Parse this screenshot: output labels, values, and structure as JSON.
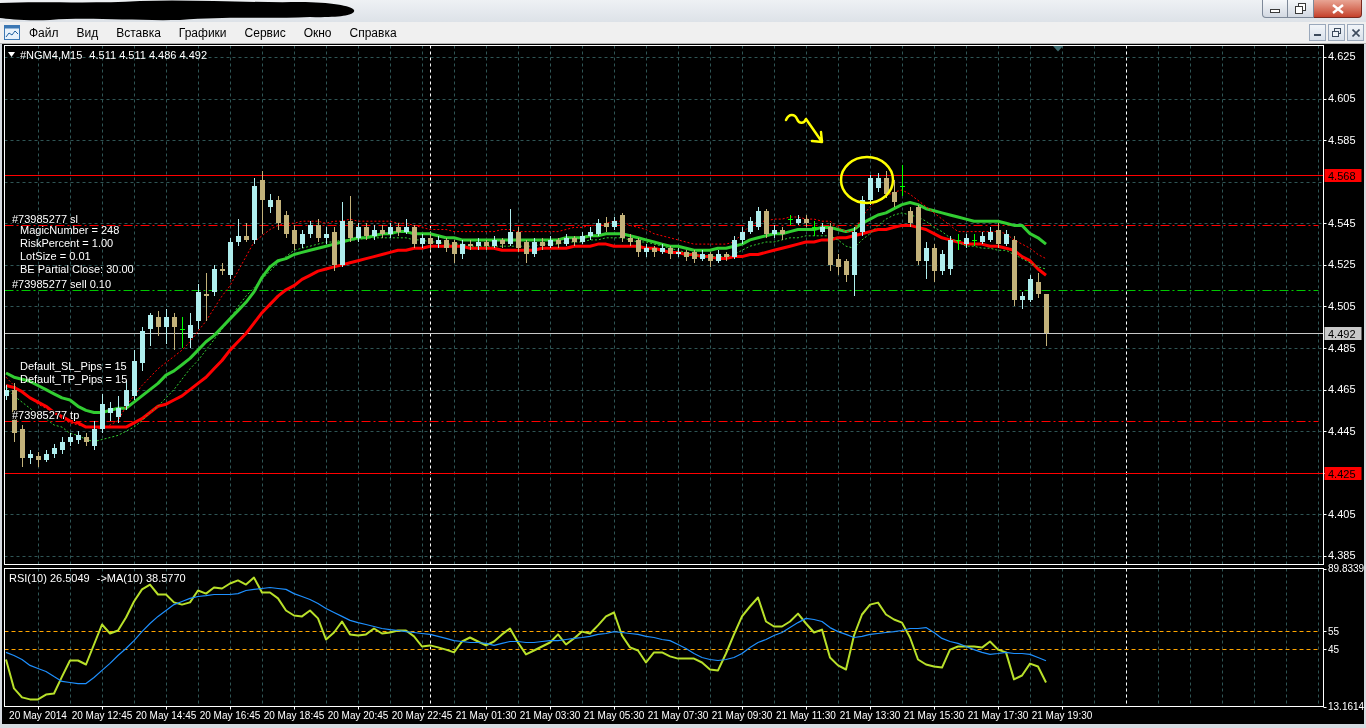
{
  "menu_bar": {
    "items": [
      "Файл",
      "Вид",
      "Вставка",
      "Графики",
      "Сервис",
      "Окно",
      "Справка"
    ]
  },
  "chart": {
    "comment_groups": [
      [
        "MagicNumber = 248",
        "RiskPercent = 1.00",
        "LotSize = 0.01",
        "BE Partial Close: 30.00"
      ],
      [
        "Default_SL_Pips = 15",
        "Default_TP_Pips = 15"
      ]
    ],
    "chart_data": [
      {
        "type": "candlestick",
        "title": "#NGM4,M15",
        "subtitle": "4.511 4.511 4.486 4.492",
        "ylim": [
          4.3809,
          4.6305
        ],
        "yticks": [
          4.385,
          4.405,
          4.425,
          4.445,
          4.465,
          4.485,
          4.505,
          4.525,
          4.545,
          4.585,
          4.605,
          4.625
        ],
        "grid": true,
        "ohlc": [
          [
            4.462,
            4.467,
            4.46,
            4.465
          ],
          [
            4.465,
            4.468,
            4.44,
            4.444
          ],
          [
            4.446,
            4.448,
            4.428,
            4.432
          ],
          [
            4.432,
            4.436,
            4.429,
            4.434
          ],
          [
            4.433,
            4.435,
            4.428,
            4.431
          ],
          [
            4.431,
            4.436,
            4.43,
            4.434
          ],
          [
            4.434,
            4.439,
            4.432,
            4.437
          ],
          [
            4.436,
            4.442,
            4.434,
            4.44
          ],
          [
            4.44,
            4.444,
            4.438,
            4.442
          ],
          [
            4.441,
            4.445,
            4.439,
            4.443
          ],
          [
            4.442,
            4.444,
            4.438,
            4.44
          ],
          [
            4.438,
            4.45,
            4.436,
            4.446
          ],
          [
            4.446,
            4.463,
            4.444,
            4.458
          ],
          [
            4.454,
            4.459,
            4.45,
            4.456
          ],
          [
            4.452,
            4.462,
            4.449,
            4.456
          ],
          [
            4.457,
            4.469,
            4.455,
            4.465
          ],
          [
            4.462,
            4.484,
            4.46,
            4.479
          ],
          [
            4.478,
            4.495,
            4.474,
            4.493
          ],
          [
            4.494,
            4.502,
            4.486,
            4.501
          ],
          [
            4.5,
            4.503,
            4.491,
            4.495
          ],
          [
            4.495,
            4.504,
            4.487,
            4.5
          ],
          [
            4.5,
            4.502,
            4.484,
            4.495
          ],
          [
            4.494,
            4.5,
            4.485,
            4.494
          ],
          [
            4.49,
            4.502,
            4.485,
            4.496
          ],
          [
            4.498,
            4.516,
            4.494,
            4.512
          ],
          [
            4.511,
            4.521,
            4.498,
            4.51
          ],
          [
            4.512,
            4.525,
            4.51,
            4.523
          ],
          [
            4.523,
            4.526,
            4.52,
            4.522
          ],
          [
            4.52,
            4.538,
            4.518,
            4.536
          ],
          [
            4.536,
            4.547,
            4.534,
            4.539
          ],
          [
            4.539,
            4.545,
            4.536,
            4.537
          ],
          [
            4.537,
            4.567,
            4.535,
            4.563
          ],
          [
            4.566,
            4.57,
            4.54,
            4.556
          ],
          [
            4.553,
            4.559,
            4.55,
            4.556
          ],
          [
            4.556,
            4.558,
            4.542,
            4.545
          ],
          [
            4.549,
            4.551,
            4.538,
            4.54
          ],
          [
            4.542,
            4.544,
            4.532,
            4.535
          ],
          [
            4.535,
            4.542,
            4.533,
            4.54
          ],
          [
            4.54,
            4.546,
            4.538,
            4.544
          ],
          [
            4.544,
            4.547,
            4.536,
            4.538
          ],
          [
            4.538,
            4.543,
            4.535,
            4.54
          ],
          [
            4.541,
            4.543,
            4.522,
            4.525
          ],
          [
            4.525,
            4.555,
            4.524,
            4.546
          ],
          [
            4.546,
            4.558,
            4.536,
            4.538
          ],
          [
            4.538,
            4.545,
            4.536,
            4.543
          ],
          [
            4.543,
            4.545,
            4.537,
            4.539
          ],
          [
            4.539,
            4.544,
            4.537,
            4.542
          ],
          [
            4.542,
            4.544,
            4.538,
            4.54
          ],
          [
            4.54,
            4.545,
            4.538,
            4.543
          ],
          [
            4.543,
            4.545,
            4.539,
            4.541
          ],
          [
            4.541,
            4.547,
            4.54,
            4.543
          ],
          [
            4.543,
            4.544,
            4.533,
            4.535
          ],
          [
            4.535,
            4.54,
            4.533,
            4.538
          ],
          [
            4.538,
            4.54,
            4.532,
            4.535
          ],
          [
            4.535,
            4.539,
            4.533,
            4.537
          ],
          [
            4.537,
            4.538,
            4.531,
            4.533
          ],
          [
            4.536,
            4.537,
            4.526,
            4.53
          ],
          [
            4.53,
            4.537,
            4.528,
            4.535
          ],
          [
            4.535,
            4.537,
            4.532,
            4.534
          ],
          [
            4.534,
            4.538,
            4.532,
            4.536
          ],
          [
            4.536,
            4.537,
            4.532,
            4.534
          ],
          [
            4.534,
            4.539,
            4.533,
            4.537
          ],
          [
            4.537,
            4.538,
            4.533,
            4.535
          ],
          [
            4.535,
            4.552,
            4.534,
            4.541
          ],
          [
            4.541,
            4.543,
            4.531,
            4.533
          ],
          [
            4.536,
            4.537,
            4.526,
            4.53
          ],
          [
            4.53,
            4.538,
            4.529,
            4.536
          ],
          [
            4.536,
            4.538,
            4.532,
            4.534
          ],
          [
            4.534,
            4.539,
            4.533,
            4.537
          ],
          [
            4.537,
            4.538,
            4.533,
            4.535
          ],
          [
            4.535,
            4.54,
            4.534,
            4.538
          ],
          [
            4.538,
            4.539,
            4.534,
            4.536
          ],
          [
            4.536,
            4.541,
            4.535,
            4.539
          ],
          [
            4.539,
            4.543,
            4.537,
            4.541
          ],
          [
            4.54,
            4.547,
            4.539,
            4.545
          ],
          [
            4.545,
            4.548,
            4.541,
            4.543
          ],
          [
            4.543,
            4.548,
            4.542,
            4.546
          ],
          [
            4.549,
            4.55,
            4.536,
            4.538
          ],
          [
            4.538,
            4.54,
            4.534,
            4.536
          ],
          [
            4.537,
            4.538,
            4.529,
            4.531
          ],
          [
            4.531,
            4.535,
            4.529,
            4.533
          ],
          [
            4.533,
            4.534,
            4.529,
            4.531
          ],
          [
            4.531,
            4.535,
            4.53,
            4.533
          ],
          [
            4.533,
            4.534,
            4.528,
            4.53
          ],
          [
            4.53,
            4.533,
            4.529,
            4.531
          ],
          [
            4.531,
            4.532,
            4.527,
            4.529
          ],
          [
            4.531,
            4.532,
            4.526,
            4.528
          ],
          [
            4.528,
            4.532,
            4.527,
            4.53
          ],
          [
            4.53,
            4.531,
            4.524,
            4.527
          ],
          [
            4.527,
            4.532,
            4.526,
            4.53
          ],
          [
            4.53,
            4.531,
            4.527,
            4.529
          ],
          [
            4.529,
            4.539,
            4.528,
            4.537
          ],
          [
            4.537,
            4.543,
            4.535,
            4.541
          ],
          [
            4.541,
            4.548,
            4.54,
            4.546
          ],
          [
            4.543,
            4.553,
            4.542,
            4.551
          ],
          [
            4.551,
            4.552,
            4.538,
            4.54
          ],
          [
            4.54,
            4.544,
            4.538,
            4.542
          ],
          [
            4.542,
            4.543,
            4.537,
            4.54
          ],
          [
            4.547,
            4.549,
            4.544,
            4.547
          ],
          [
            4.545,
            4.549,
            4.544,
            4.547
          ],
          [
            4.547,
            4.549,
            4.543,
            4.545
          ],
          [
            4.543,
            4.546,
            4.539,
            4.543
          ],
          [
            4.541,
            4.545,
            4.54,
            4.543
          ],
          [
            4.543,
            4.545,
            4.522,
            4.525
          ],
          [
            4.528,
            4.53,
            4.52,
            4.524
          ],
          [
            4.527,
            4.528,
            4.517,
            4.52
          ],
          [
            4.52,
            4.543,
            4.51,
            4.541
          ],
          [
            4.541,
            4.558,
            4.539,
            4.556
          ],
          [
            4.556,
            4.568,
            4.554,
            4.567
          ],
          [
            4.562,
            4.569,
            4.56,
            4.567
          ],
          [
            4.567,
            4.57,
            4.557,
            4.559
          ],
          [
            4.56,
            4.566,
            4.553,
            4.555
          ],
          [
            4.563,
            4.573,
            4.558,
            4.563
          ],
          [
            4.551,
            4.553,
            4.543,
            4.545
          ],
          [
            4.553,
            4.554,
            4.525,
            4.527
          ],
          [
            4.527,
            4.536,
            4.518,
            4.533
          ],
          [
            4.533,
            4.535,
            4.517,
            4.522
          ],
          [
            4.522,
            4.532,
            4.52,
            4.53
          ],
          [
            4.523,
            4.539,
            4.52,
            4.537
          ],
          [
            4.537,
            4.54,
            4.532,
            4.537
          ],
          [
            4.535,
            4.54,
            4.533,
            4.538
          ],
          [
            4.537,
            4.54,
            4.534,
            4.537
          ],
          [
            4.536,
            4.541,
            4.535,
            4.539
          ],
          [
            4.537,
            4.543,
            4.536,
            4.541
          ],
          [
            4.542,
            4.545,
            4.533,
            4.535
          ],
          [
            4.535,
            4.542,
            4.534,
            4.54
          ],
          [
            4.537,
            4.539,
            4.505,
            4.508
          ],
          [
            4.508,
            4.512,
            4.504,
            4.51
          ],
          [
            4.508,
            4.52,
            4.507,
            4.518
          ],
          [
            4.517,
            4.521,
            4.509,
            4.511
          ],
          [
            4.511,
            4.511,
            4.486,
            4.492
          ]
        ],
        "series": [
          {
            "type": "line",
            "color": "#32cd32",
            "line_style": "solid",
            "values": [
              4.473,
              4.471,
              4.47,
              4.469,
              4.467,
              4.465,
              4.463,
              4.461,
              4.46,
              4.457,
              4.455,
              4.454,
              4.454,
              4.455,
              4.456,
              4.456,
              4.459,
              4.462,
              4.465,
              4.468,
              4.472,
              4.474,
              4.477,
              4.48,
              4.484,
              4.488,
              4.491,
              4.495,
              4.499,
              4.503,
              4.507,
              4.512,
              4.519,
              4.524,
              4.527,
              4.528,
              4.53,
              4.531,
              4.532,
              4.533,
              4.534,
              4.535,
              4.536,
              4.537,
              4.538,
              4.538,
              4.539,
              4.54,
              4.54,
              4.541,
              4.541,
              4.54,
              4.54,
              4.54,
              4.539,
              4.538,
              4.538,
              4.537,
              4.537,
              4.537,
              4.537,
              4.537,
              4.537,
              4.537,
              4.537,
              4.537,
              4.537,
              4.537,
              4.537,
              4.537,
              4.538,
              4.538,
              4.538,
              4.539,
              4.539,
              4.54,
              4.54,
              4.54,
              4.539,
              4.538,
              4.537,
              4.536,
              4.535,
              4.534,
              4.534,
              4.533,
              4.532,
              4.532,
              4.532,
              4.533,
              4.533,
              4.534,
              4.535,
              4.537,
              4.538,
              4.539,
              4.54,
              4.54,
              4.541,
              4.542,
              4.542,
              4.542,
              4.543,
              4.543,
              4.542,
              4.541,
              4.542,
              4.545,
              4.547,
              4.549,
              4.55,
              4.552,
              4.554,
              4.555,
              4.554,
              4.552,
              4.551,
              4.55,
              4.549,
              4.548,
              4.547,
              4.546,
              4.546,
              4.546,
              4.546,
              4.545,
              4.544,
              4.544,
              4.54,
              4.538,
              4.535
            ]
          },
          {
            "type": "line",
            "color": "#ff0000",
            "line_style": "solid",
            "values": [
              4.467,
              4.466,
              4.464,
              4.461,
              4.459,
              4.457,
              4.454,
              4.452,
              4.45,
              4.449,
              4.447,
              4.447,
              4.447,
              4.447,
              4.447,
              4.447,
              4.449,
              4.451,
              4.454,
              4.457,
              4.458,
              4.46,
              4.462,
              4.465,
              4.468,
              4.471,
              4.475,
              4.479,
              4.484,
              4.488,
              4.492,
              4.497,
              4.502,
              4.506,
              4.51,
              4.513,
              4.515,
              4.518,
              4.52,
              4.522,
              4.523,
              4.524,
              4.525,
              4.526,
              4.527,
              4.528,
              4.529,
              4.53,
              4.531,
              4.532,
              4.532,
              4.533,
              4.533,
              4.534,
              4.534,
              4.534,
              4.534,
              4.534,
              4.533,
              4.533,
              4.533,
              4.533,
              4.532,
              4.532,
              4.532,
              4.532,
              4.532,
              4.533,
              4.533,
              4.533,
              4.533,
              4.534,
              4.534,
              4.534,
              4.535,
              4.535,
              4.534,
              4.534,
              4.534,
              4.534,
              4.533,
              4.533,
              4.532,
              4.531,
              4.531,
              4.53,
              4.53,
              4.529,
              4.529,
              4.528,
              4.528,
              4.529,
              4.529,
              4.53,
              4.53,
              4.531,
              4.532,
              4.533,
              4.534,
              4.535,
              4.536,
              4.536,
              4.537,
              4.537,
              4.538,
              4.538,
              4.539,
              4.54,
              4.541,
              4.542,
              4.542,
              4.543,
              4.544,
              4.544,
              4.543,
              4.542,
              4.54,
              4.538,
              4.537,
              4.536,
              4.535,
              4.535,
              4.535,
              4.534,
              4.534,
              4.533,
              4.532,
              4.529,
              4.527,
              4.523,
              4.52
            ]
          },
          {
            "type": "line",
            "color": "#ff0000",
            "line_style": "dotted",
            "values": [
              4.471,
              4.467,
              4.464,
              4.461,
              4.458,
              4.456,
              4.454,
              4.451,
              4.449,
              4.448,
              4.447,
              4.447,
              4.446,
              4.448,
              4.45,
              4.457,
              4.462,
              4.467,
              4.471,
              4.475,
              4.478,
              4.481,
              4.484,
              4.488,
              4.493,
              4.498,
              4.504,
              4.51,
              4.515,
              4.522,
              4.529,
              4.536,
              4.539,
              4.542,
              4.544,
              4.545,
              4.545,
              4.546,
              4.546,
              4.546,
              4.545,
              4.546,
              4.546,
              4.547,
              4.546,
              4.546,
              4.546,
              4.546,
              4.546,
              4.545,
              4.545,
              4.544,
              4.543,
              4.542,
              4.542,
              4.542,
              4.541,
              4.541,
              4.541,
              4.541,
              4.541,
              4.541,
              4.542,
              4.542,
              4.541,
              4.541,
              4.541,
              4.541,
              4.541,
              4.541,
              4.542,
              4.543,
              4.543,
              4.544,
              4.544,
              4.545,
              4.546,
              4.546,
              4.544,
              4.543,
              4.542,
              4.54,
              4.539,
              4.538,
              4.537,
              4.536,
              4.535,
              4.535,
              4.535,
              4.535,
              4.535,
              4.536,
              4.54,
              4.544,
              4.546,
              4.546,
              4.547,
              4.547,
              4.548,
              4.548,
              4.547,
              4.547,
              4.546,
              4.546,
              4.543,
              4.541,
              4.541,
              4.548,
              4.553,
              4.556,
              4.558,
              4.56,
              4.561,
              4.559,
              4.556,
              4.553,
              4.55,
              4.547,
              4.544,
              4.541,
              4.541,
              4.541,
              4.541,
              4.541,
              4.541,
              4.54,
              4.537,
              4.535,
              4.533,
              4.53,
              4.528
            ]
          },
          {
            "type": "line",
            "color": "#32cd32",
            "line_style": "dotted",
            "values": [
              4.466,
              4.462,
              4.459,
              4.456,
              4.453,
              4.451,
              4.448,
              4.447,
              4.444,
              4.443,
              4.441,
              4.44,
              4.441,
              4.442,
              4.443,
              4.445,
              4.447,
              4.45,
              4.454,
              4.457,
              4.461,
              4.465,
              4.47,
              4.475,
              4.479,
              4.484,
              4.489,
              4.494,
              4.499,
              4.505,
              4.51,
              4.514,
              4.518,
              4.522,
              4.526,
              4.529,
              4.532,
              4.533,
              4.534,
              4.535,
              4.536,
              4.536,
              4.537,
              4.537,
              4.537,
              4.538,
              4.538,
              4.538,
              4.538,
              4.538,
              4.538,
              4.537,
              4.537,
              4.536,
              4.536,
              4.535,
              4.535,
              4.535,
              4.534,
              4.534,
              4.534,
              4.534,
              4.534,
              4.534,
              4.534,
              4.534,
              4.534,
              4.535,
              4.535,
              4.535,
              4.536,
              4.536,
              4.536,
              4.537,
              4.537,
              4.538,
              4.538,
              4.538,
              4.537,
              4.536,
              4.536,
              4.535,
              4.534,
              4.533,
              4.532,
              4.531,
              4.53,
              4.529,
              4.529,
              4.529,
              4.529,
              4.53,
              4.532,
              4.534,
              4.535,
              4.536,
              4.536,
              4.537,
              4.538,
              4.538,
              4.539,
              4.539,
              4.539,
              4.539,
              4.537,
              4.534,
              4.533,
              4.537,
              4.54,
              4.544,
              4.547,
              4.549,
              4.55,
              4.549,
              4.548,
              4.546,
              4.543,
              4.541,
              4.538,
              4.536,
              4.534,
              4.534,
              4.533,
              4.533,
              4.532,
              4.532,
              4.53,
              4.528,
              4.526,
              4.524,
              4.523
            ]
          }
        ],
        "ref_lines": [
          {
            "axis": "y",
            "value": 4.544,
            "label": "#73985277 sl",
            "color": "#ff0000",
            "line_style": "dashdot"
          },
          {
            "axis": "y",
            "value": 4.513,
            "label": "#73985277 sell 0.10",
            "color": "#00c800",
            "line_style": "dashdot"
          },
          {
            "axis": "y",
            "value": 4.45,
            "label": "#73985277 tp",
            "color": "#ff0000",
            "line_style": "dashdot"
          },
          {
            "axis": "y",
            "value": 4.568,
            "label": "4.568",
            "color": "#ff0000",
            "line_style": "solid"
          },
          {
            "axis": "y",
            "value": 4.492,
            "label": "4.492",
            "color": "#c8c8c8",
            "line_style": "solid"
          },
          {
            "axis": "y",
            "value": 4.425,
            "label": "4.425",
            "color": "#ff0000",
            "line_style": "solid"
          }
        ]
      },
      {
        "type": "line",
        "title": "RSI(10) 26.5049",
        "subtitle": "->MA(10) 38.5770",
        "ylim": [
          13.1614,
          89.8339
        ],
        "yticks": [
          13.1614,
          45,
          55,
          89.8339
        ],
        "grid": "x",
        "categories": [
          null,
          null,
          null,
          null,
          "20 May 2014",
          null,
          null,
          null,
          null,
          null,
          null,
          null,
          "20 May 12:45",
          null,
          null,
          null,
          null,
          null,
          null,
          null,
          "20 May 14:45",
          null,
          null,
          null,
          null,
          null,
          null,
          null,
          "20 May 16:45",
          null,
          null,
          null,
          null,
          null,
          null,
          null,
          "20 May 18:45",
          null,
          null,
          null,
          null,
          null,
          null,
          null,
          "20 May 20:45",
          null,
          null,
          null,
          null,
          null,
          null,
          null,
          "20 May 22:45",
          null,
          null,
          null,
          null,
          null,
          null,
          null,
          "21 May 01:30",
          null,
          null,
          null,
          null,
          null,
          null,
          null,
          "21 May 03:30",
          null,
          null,
          null,
          null,
          null,
          null,
          null,
          "21 May 05:30",
          null,
          null,
          null,
          null,
          null,
          null,
          null,
          "21 May 07:30",
          null,
          null,
          null,
          null,
          null,
          null,
          null,
          "21 May 09:30",
          null,
          null,
          null,
          null,
          null,
          null,
          null,
          "21 May 11:30",
          null,
          null,
          null,
          null,
          null,
          null,
          null,
          "21 May 13:30",
          null,
          null,
          null,
          null,
          null,
          null,
          null,
          "21 May 15:30",
          null,
          null,
          null,
          null,
          null,
          null,
          null,
          "21 May 17:30",
          null,
          null,
          null,
          null,
          null,
          null,
          null,
          "21 May 19:30"
        ],
        "series": [
          {
            "color": "#b8e02a",
            "values": [
              39.3,
              23.2,
              18.2,
              17.1,
              17.1,
              19.8,
              20.4,
              29.8,
              38.7,
              38.7,
              36.5,
              47.6,
              58.7,
              53.7,
              55.4,
              62.6,
              71.5,
              78.2,
              80.9,
              75.4,
              75.4,
              71.0,
              69.8,
              71.0,
              77.6,
              75.9,
              79.3,
              78.7,
              81.5,
              83.2,
              80.9,
              84.8,
              76.5,
              76.5,
              73.2,
              66.5,
              63.7,
              63.2,
              66.5,
              62.1,
              50.4,
              54.3,
              60.4,
              53.2,
              52.6,
              53.2,
              56.5,
              53.7,
              54.3,
              55.4,
              55.4,
              52.1,
              46.5,
              47.1,
              46.0,
              44.8,
              43.2,
              49.3,
              51.5,
              49.3,
              47.1,
              49.3,
              53.2,
              56.5,
              48.7,
              42.1,
              44.3,
              46.5,
              48.7,
              53.2,
              47.6,
              51.0,
              54.8,
              53.7,
              58.2,
              63.2,
              65.4,
              52.6,
              46.0,
              44.3,
              37.6,
              43.2,
              43.2,
              41.0,
              39.8,
              39.8,
              39.8,
              37.6,
              33.7,
              33.2,
              42.6,
              53.2,
              63.2,
              68.7,
              73.7,
              60.4,
              57.6,
              57.6,
              60.4,
              64.8,
              59.3,
              54.3,
              55.9,
              40.4,
              36.0,
              33.7,
              52.6,
              64.3,
              69.8,
              70.9,
              64.3,
              61.5,
              59.8,
              51.5,
              39.3,
              36.5,
              35.4,
              34.8,
              44.8,
              46.5,
              46.5,
              46.5,
              45.9,
              49.3,
              44.8,
              43.2,
              28.2,
              30.4,
              37.0,
              35.4,
              26.5,
              null,
              null
            ]
          },
          {
            "color": "#1e90ff",
            "values": [
              43.2,
              41.5,
              39.3,
              36.0,
              34.3,
              32.6,
              29.8,
              27.1,
              26.5,
              25.9,
              25.9,
              29.3,
              33.2,
              37.1,
              41.5,
              45.4,
              49.8,
              54.8,
              59.3,
              63.2,
              66.5,
              69.8,
              71.5,
              73.2,
              74.3,
              74.8,
              75.4,
              75.4,
              75.4,
              75.9,
              77.6,
              78.2,
              78.7,
              79.3,
              78.7,
              78.2,
              75.9,
              74.3,
              72.6,
              70.4,
              67.6,
              65.4,
              63.2,
              61.0,
              59.8,
              58.7,
              57.6,
              56.5,
              55.9,
              55.4,
              54.8,
              54.3,
              53.7,
              53.2,
              52.1,
              51.0,
              49.8,
              49.3,
              48.7,
              48.7,
              48.2,
              47.1,
              48.2,
              49.3,
              49.3,
              48.7,
              48.7,
              49.3,
              49.8,
              49.8,
              50.4,
              51.0,
              51.5,
              52.1,
              53.2,
              53.7,
              54.8,
              54.3,
              53.7,
              53.2,
              52.1,
              51.5,
              50.4,
              49.8,
              47.6,
              45.4,
              42.6,
              40.4,
              39.3,
              38.7,
              39.3,
              40.4,
              42.6,
              45.9,
              48.7,
              50.4,
              52.6,
              54.3,
              57.0,
              59.8,
              62.1,
              61.5,
              60.4,
              57.0,
              54.8,
              53.2,
              51.5,
              52.1,
              53.2,
              53.7,
              54.3,
              54.8,
              55.4,
              56.5,
              56.5,
              57.0,
              54.3,
              51.0,
              49.3,
              48.2,
              46.5,
              44.8,
              43.2,
              42.1,
              42.6,
              43.2,
              42.6,
              42.6,
              42.1,
              40.4,
              38.6,
              null,
              null
            ]
          }
        ],
        "ref_lines": [
          {
            "axis": "y",
            "value": 55,
            "color": "#ffa500",
            "line_style": "dashed"
          },
          {
            "axis": "y",
            "value": 45,
            "color": "#ffa500",
            "line_style": "dashed"
          }
        ]
      }
    ]
  }
}
